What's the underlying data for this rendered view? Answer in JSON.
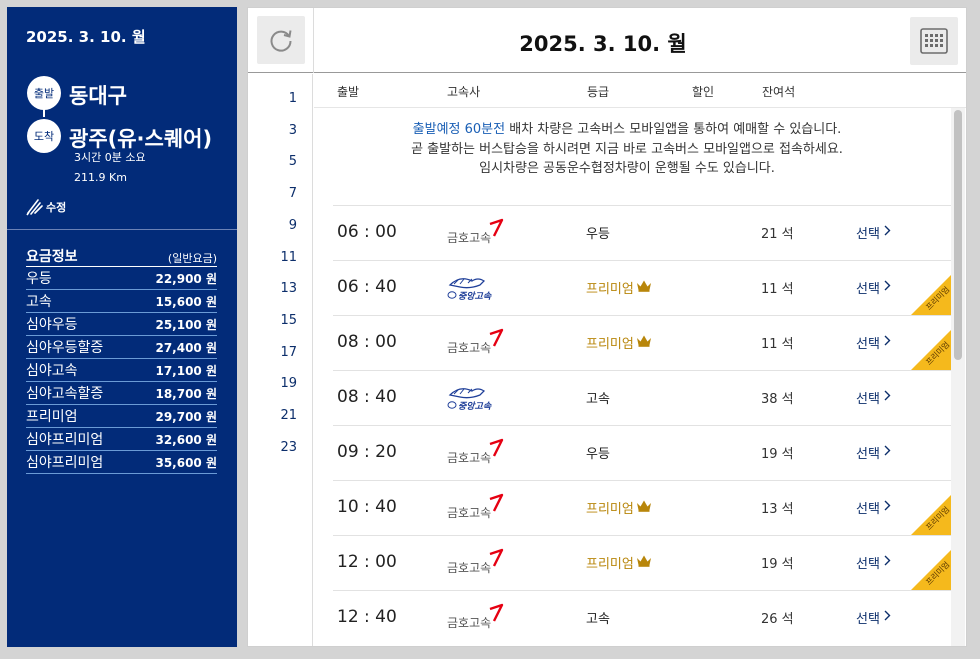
{
  "left": {
    "date": "2025. 3. 10. 월",
    "departure_badge": "출발",
    "departure": "동대구",
    "arrival_badge": "도착",
    "arrival": "광주(유·스퀘어)",
    "duration": "3시간 0분 소요",
    "distance": "211.9 Km",
    "edit_label": "수정",
    "fare_title": "요금정보",
    "fare_subtitle": "(일반요금)",
    "fares": [
      {
        "name": "우등",
        "price": "22,900 원"
      },
      {
        "name": "고속",
        "price": "15,600 원"
      },
      {
        "name": "심야우등",
        "price": "25,100 원"
      },
      {
        "name": "심야우등할증",
        "price": "27,400 원"
      },
      {
        "name": "심야고속",
        "price": "17,100 원"
      },
      {
        "name": "심야고속할증",
        "price": "18,700 원"
      },
      {
        "name": "프리미엄",
        "price": "29,700 원"
      },
      {
        "name": "심야프리미엄",
        "price": "32,600 원"
      },
      {
        "name": "심야프리미엄",
        "price": "35,600 원"
      }
    ]
  },
  "main": {
    "date": "2025. 3. 10. 월",
    "icons": {
      "refresh": "refresh-icon",
      "calendar": "calendar-icon"
    },
    "hours": [
      "1",
      "3",
      "5",
      "7",
      "9",
      "11",
      "13",
      "15",
      "17",
      "19",
      "21",
      "23"
    ],
    "columns": {
      "depart": "출발",
      "company": "고속사",
      "grade": "등급",
      "discount": "할인",
      "seats": "잔여석"
    },
    "notice": {
      "highlight": "출발예정 60분전",
      "line1_rest": " 배차 차량은 고속버스 모바일앱을 통하여 예매할 수 있습니다.",
      "line2": "곧 출발하는 버스탑승을 하시려면 지금 바로 고속버스 모바일앱으로 접속하세요.",
      "line3": "임시차량은 공동운수협정차량이 운행될 수도 있습니다."
    },
    "select_label": "선택",
    "ribbon_label": "프리미엄",
    "rows": [
      {
        "time": "06 : 00",
        "company": "금호고속",
        "grade": "우등",
        "premium": false,
        "seats": "21 석"
      },
      {
        "time": "06 : 40",
        "company": "중앙고속",
        "grade": "프리미엄",
        "premium": true,
        "seats": "11 석"
      },
      {
        "time": "08 : 00",
        "company": "금호고속",
        "grade": "프리미엄",
        "premium": true,
        "seats": "11 석"
      },
      {
        "time": "08 : 40",
        "company": "중앙고속",
        "grade": "고속",
        "premium": false,
        "seats": "38 석"
      },
      {
        "time": "09 : 20",
        "company": "금호고속",
        "grade": "우등",
        "premium": false,
        "seats": "19 석"
      },
      {
        "time": "10 : 40",
        "company": "금호고속",
        "grade": "프리미엄",
        "premium": true,
        "seats": "13 석"
      },
      {
        "time": "12 : 00",
        "company": "금호고속",
        "grade": "프리미엄",
        "premium": true,
        "seats": "19 석"
      },
      {
        "time": "12 : 40",
        "company": "금호고속",
        "grade": "고속",
        "premium": false,
        "seats": "26 석"
      }
    ]
  },
  "colors": {
    "navy": "#022b79",
    "premium": "#b8860b",
    "ribbon": "#f5b91c",
    "kumho_red": "#e60012",
    "jungang_blue": "#1f3f99"
  }
}
